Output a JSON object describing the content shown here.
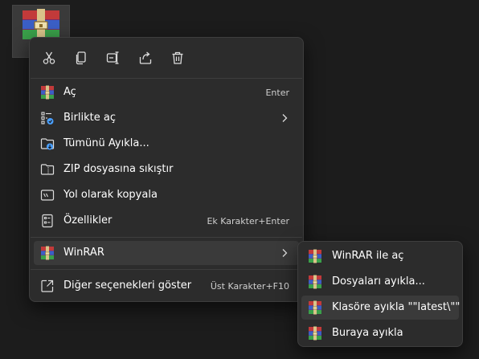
{
  "desktop": {
    "icon": "winrar-archive-icon"
  },
  "toolbar": {
    "buttons": [
      {
        "name": "cut-icon"
      },
      {
        "name": "copy-icon"
      },
      {
        "name": "rename-icon"
      },
      {
        "name": "share-icon"
      },
      {
        "name": "delete-icon"
      }
    ]
  },
  "menu": {
    "items": [
      {
        "label": "Aç",
        "shortcut": "Enter",
        "icon": "winrar-icon"
      },
      {
        "label": "Birlikte aç",
        "shortcut": "",
        "icon": "open-with-icon",
        "has_submenu": true
      },
      {
        "label": "Tümünü Ayıkla...",
        "shortcut": "",
        "icon": "extract-all-icon"
      },
      {
        "label": "ZIP dosyasına sıkıştır",
        "shortcut": "",
        "icon": "zip-folder-icon"
      },
      {
        "label": "Yol olarak kopyala",
        "shortcut": "",
        "icon": "copy-path-icon"
      },
      {
        "label": "Özellikler",
        "shortcut": "Ek Karakter+Enter",
        "icon": "properties-icon"
      }
    ],
    "winrar": {
      "label": "WinRAR",
      "icon": "winrar-icon",
      "has_submenu": true
    },
    "more": {
      "label": "Diğer seçenekleri göster",
      "shortcut": "Üst Karakter+F10",
      "icon": "more-options-icon"
    }
  },
  "submenu": {
    "items": [
      {
        "label": "WinRAR ile aç",
        "icon": "winrar-icon"
      },
      {
        "label": "Dosyaları ayıkla...",
        "icon": "winrar-icon"
      },
      {
        "label": "Klasöre ayıkla \"\"latest\\\"\"",
        "icon": "winrar-icon"
      },
      {
        "label": "Buraya ayıkla",
        "icon": "winrar-icon"
      }
    ]
  },
  "colors": {
    "menu_bg": "#2c2c2c",
    "hover_bg": "#3a3a3a",
    "accent_blue": "#4aa0ff"
  }
}
